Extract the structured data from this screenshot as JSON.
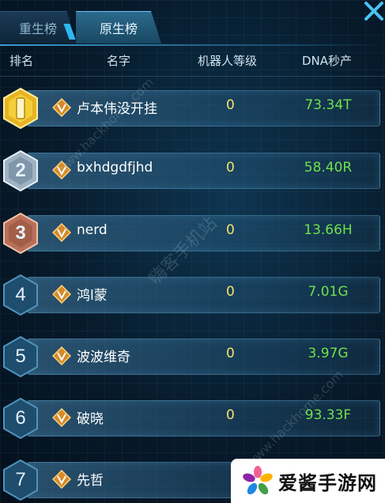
{
  "tabs": [
    {
      "label": "重生榜",
      "active": false
    },
    {
      "label": "原生榜",
      "active": true
    }
  ],
  "header": {
    "rank": "排名",
    "name": "名字",
    "robot_level": "机器人等级",
    "dna_per_sec": "DNA秒产"
  },
  "rows": [
    {
      "rank": "1",
      "medal": "gold-medal-icon",
      "name": "卢本伟没开挂",
      "level": "0",
      "dna": "73.34T"
    },
    {
      "rank": "2",
      "medal": "silver-medal-icon",
      "name": "bxhdgdfjhd",
      "level": "0",
      "dna": "58.40R"
    },
    {
      "rank": "3",
      "medal": "bronze-medal-icon",
      "name": "nerd",
      "level": "0",
      "dna": "13.66H"
    },
    {
      "rank": "4",
      "medal": "blue-hex-icon",
      "name": "鸿l蒙",
      "level": "0",
      "dna": "7.01G"
    },
    {
      "rank": "5",
      "medal": "blue-hex-icon",
      "name": "波波维奇",
      "level": "0",
      "dna": "3.97G"
    },
    {
      "rank": "6",
      "medal": "blue-hex-icon",
      "name": "破晓",
      "level": "0",
      "dna": "93.33F"
    },
    {
      "rank": "7",
      "medal": "blue-hex-icon",
      "name": "先哲",
      "level": "",
      "dna": ""
    }
  ],
  "watermarks": {
    "site_url": "www.hackhome.com",
    "site_name": "嗨客手机站",
    "logo_text": "爱酱手游网"
  },
  "colors": {
    "dna_green": "#6fe04d",
    "level_yellow": "#f5e06a",
    "accent_cyan": "#2eb6f0"
  }
}
